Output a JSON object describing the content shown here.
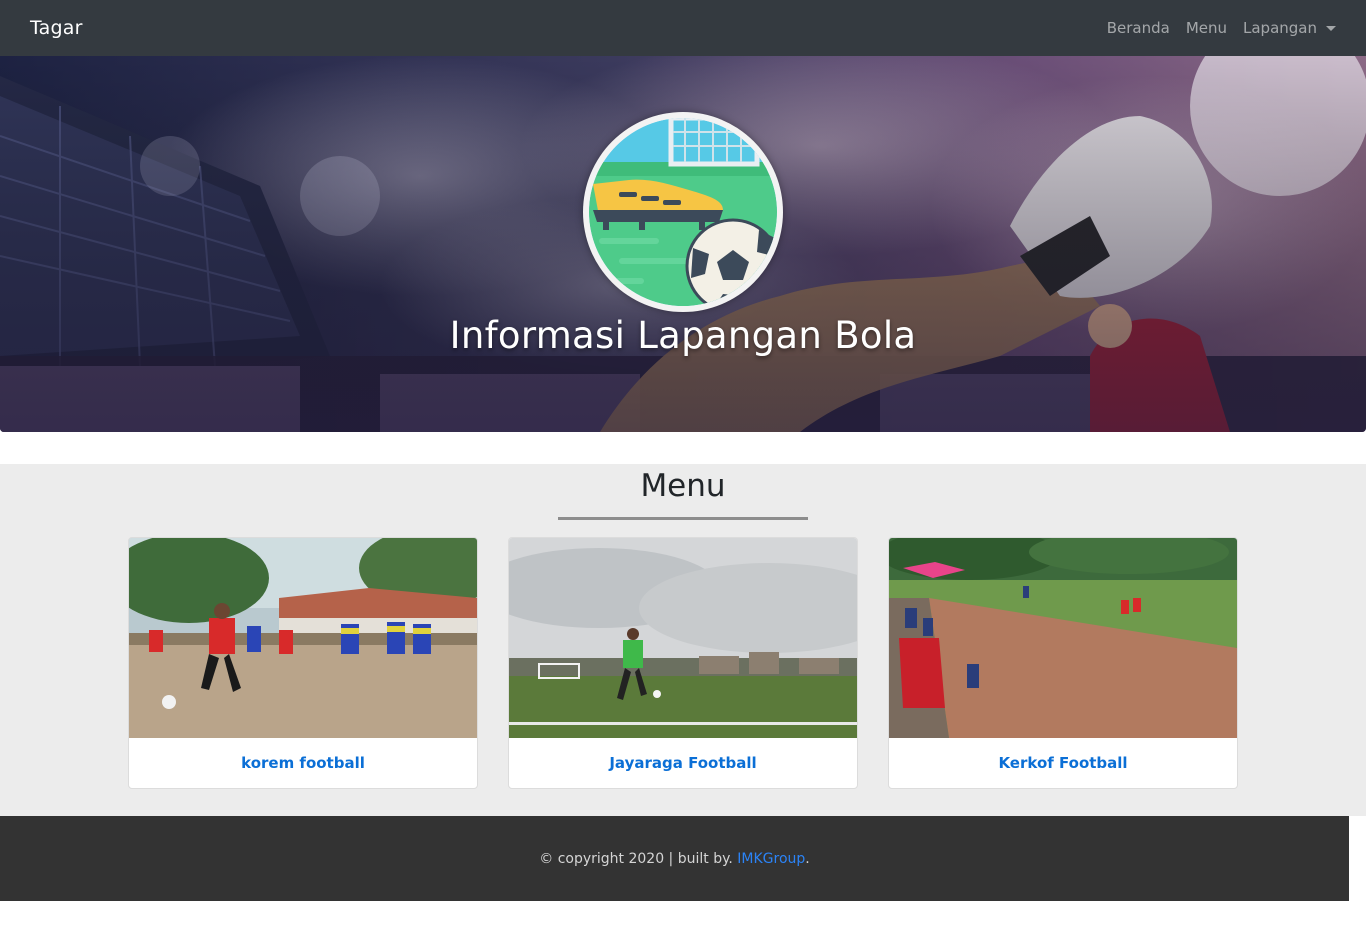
{
  "navbar": {
    "brand": "Tagar",
    "links": [
      {
        "label": "Beranda"
      },
      {
        "label": "Menu"
      },
      {
        "label": "Lapangan"
      }
    ]
  },
  "hero": {
    "title": "Informasi Lapangan Bola",
    "logo_icon": "football-field-shoe-ball-icon"
  },
  "menu": {
    "title": "Menu",
    "cards": [
      {
        "title": "korem football",
        "image": "korem-football-photo"
      },
      {
        "title": "Jayaraga Football",
        "image": "jayaraga-football-photo"
      },
      {
        "title": "Kerkof Football",
        "image": "kerkof-football-photo"
      }
    ]
  },
  "footer": {
    "text": "© copyright 2020 | built by. ",
    "link": "IMKGroup",
    "suffix": "."
  },
  "colors": {
    "navbar_bg": "#343a40",
    "section_bg": "#ececec",
    "footer_bg": "#333333",
    "link_blue": "#0b6fd6"
  }
}
